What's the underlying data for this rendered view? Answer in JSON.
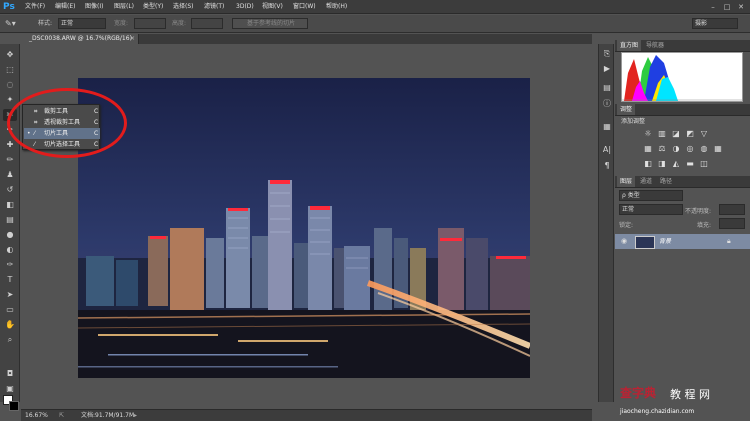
{
  "menu": {
    "logo": "Ps",
    "items": [
      "文件(F)",
      "编辑(E)",
      "图像(I)",
      "图层(L)",
      "类型(Y)",
      "选择(S)",
      "滤镜(T)",
      "3D(D)",
      "视图(V)",
      "窗口(W)",
      "帮助(H)"
    ],
    "window_buttons": [
      "–",
      "□",
      "✕"
    ]
  },
  "options": {
    "style_label": "样式:",
    "style_value": "正常",
    "width_label": "宽度:",
    "height_label": "高度:",
    "slice_from_guides": "基于参考线的切片",
    "workspace": "摄影"
  },
  "document": {
    "tab_title": "_DSC0038.ARW @ 16.7%(RGB/16)",
    "close": "×",
    "zoom": "16.67%",
    "doc_info": "文档:91.7M/91.7M"
  },
  "flyout": {
    "items": [
      {
        "label": "裁剪工具",
        "shortcut": "C",
        "selected": false
      },
      {
        "label": "透视裁剪工具",
        "shortcut": "C",
        "selected": false
      },
      {
        "label": "切片工具",
        "shortcut": "C",
        "selected": true
      },
      {
        "label": "切片选择工具",
        "shortcut": "C",
        "selected": false
      }
    ]
  },
  "panels": {
    "histogram_tabs": [
      "直方图",
      "导航器"
    ],
    "adjustments_tab": "调整",
    "adjustments_title": "添加调整",
    "layers_tabs": [
      "图层",
      "通道",
      "路径"
    ],
    "kind_filter": "ρ 类型",
    "blend_mode": "正常",
    "opacity_label": "不透明度:",
    "lock_label": "锁定:",
    "fill_label": "填充:",
    "layer_name": "背景"
  },
  "watermark": {
    "brand": "查字典",
    "sub": "教 程 网",
    "url": "jiaocheng.chazidian.com"
  },
  "colors": {
    "annotation_circle": "#e21c1c",
    "ps_blue": "#31a8ff",
    "selection": "#61728a"
  }
}
